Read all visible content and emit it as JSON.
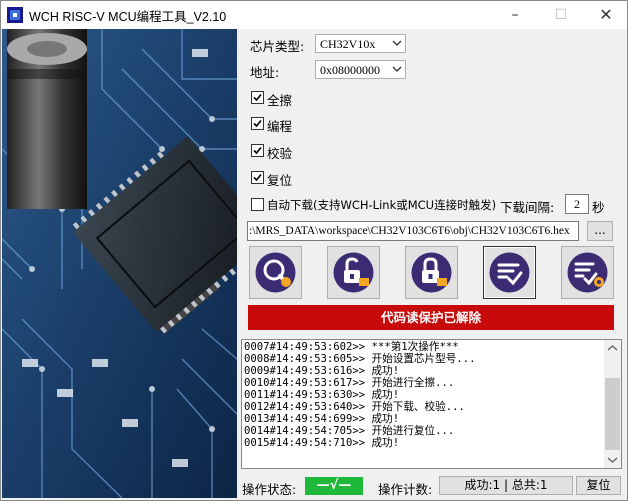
{
  "window": {
    "title": "WCH RISC-V MCU编程工具_V2.10"
  },
  "chip": {
    "label": "芯片类型:",
    "value": "CH32V10x"
  },
  "address": {
    "label": "地址:",
    "value": "0x08000000"
  },
  "options": [
    {
      "label": "全擦",
      "checked": true
    },
    {
      "label": "编程",
      "checked": true
    },
    {
      "label": "校验",
      "checked": true
    },
    {
      "label": "复位",
      "checked": true
    }
  ],
  "auto_download": {
    "label": "自动下载(支持WCH-Link或MCU连接时触发)",
    "checked": false
  },
  "interval": {
    "label": "下载间隔:",
    "value": "2",
    "unit": "秒"
  },
  "file": {
    "path": ":\\MRS_DATA\\workspace\\CH32V103C6T6\\obj\\CH32V103C6T6.hex",
    "browse_label": "..."
  },
  "banner": {
    "text": "代码读保护已解除",
    "color": "#c80a0a"
  },
  "log": [
    "0007#14:49:53:602>> ***第1次操作***",
    "0008#14:49:53:605>> 开始设置芯片型号...",
    "0009#14:49:53:616>> 成功!",
    "0010#14:49:53:617>> 开始进行全擦...",
    "0011#14:49:53:630>> 成功!",
    "0012#14:49:53:640>> 开始下载、校验...",
    "0013#14:49:54:699>> 成功!",
    "0014#14:49:54:705>> 开始进行复位...",
    "0015#14:49:54:710>> 成功!"
  ],
  "status": {
    "label": "操作状态:",
    "value": "—√—",
    "color": "#1fb83a"
  },
  "counter": {
    "label": "操作计数:",
    "text": "成功:1 | 总共:1"
  },
  "reset_button": "复位",
  "icons": [
    "search-chip-icon",
    "unlock-chip-icon",
    "lock-chip-icon",
    "checklist-icon",
    "checklist-gear-icon"
  ]
}
